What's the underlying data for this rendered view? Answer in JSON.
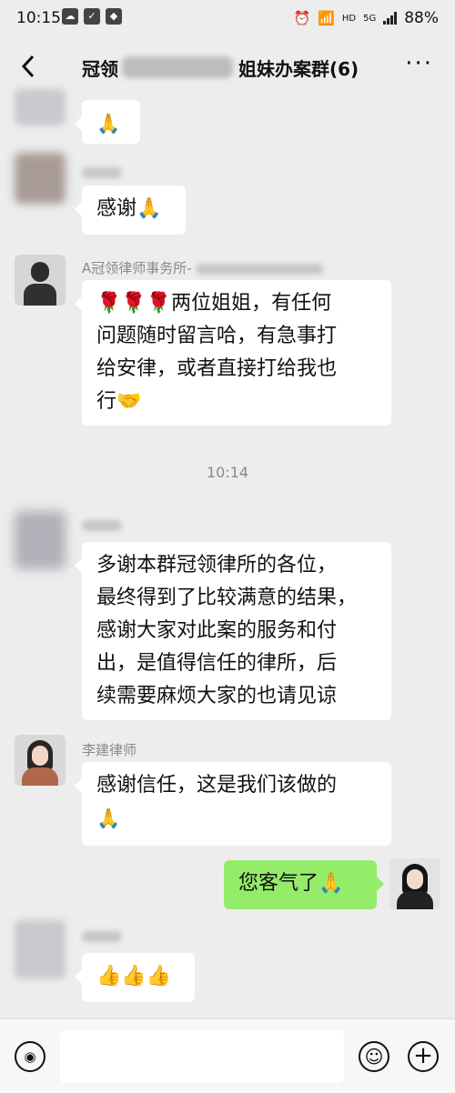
{
  "status_bar": {
    "time": "10:15",
    "battery": "88%",
    "network_hd": "HD",
    "network_5g": "5G"
  },
  "header": {
    "title_prefix": "冠领",
    "title_suffix": "姐妹办案群(6)",
    "back_icon": "chevron-left-icon",
    "more_icon": "more-dots-icon",
    "more_label": "···"
  },
  "messages": [
    {
      "side": "left",
      "sender": "",
      "text": "🙏"
    },
    {
      "side": "left",
      "sender": "",
      "text": "感谢🙏"
    },
    {
      "side": "left",
      "sender": "A冠领律师事务所-",
      "line1": "🌹🌹🌹两位姐姐，有任何",
      "line2": "问题随时留言哈，有急事打",
      "line3": "给安律，或者直接打给我也",
      "line4": "行🤝"
    },
    {
      "side": "left",
      "sender": "",
      "line1": "多谢本群冠领律所的各位，",
      "line2": "最终得到了比较满意的结果，",
      "line3": "感谢大家对此案的服务和付",
      "line4": "出，是值得信任的律所，后",
      "line5": "续需要麻烦大家的也请见谅"
    },
    {
      "side": "left",
      "sender": "李建律师",
      "line1": "感谢信任，这是我们该做的",
      "line2": "🙏"
    },
    {
      "side": "right",
      "text": "您客气了🙏"
    },
    {
      "side": "left",
      "sender": "",
      "text": "👍👍👍"
    }
  ],
  "timestamp": "10:14",
  "input_bar": {
    "voice_icon": "voice-icon",
    "emoji_icon": "emoji-icon",
    "plus_icon": "plus-icon",
    "voice_label": "◉",
    "emoji_label": "☺",
    "plus_label": "+"
  },
  "colors": {
    "background": "#ededed",
    "self_bubble": "#95ec69",
    "other_bubble": "#ffffff"
  }
}
